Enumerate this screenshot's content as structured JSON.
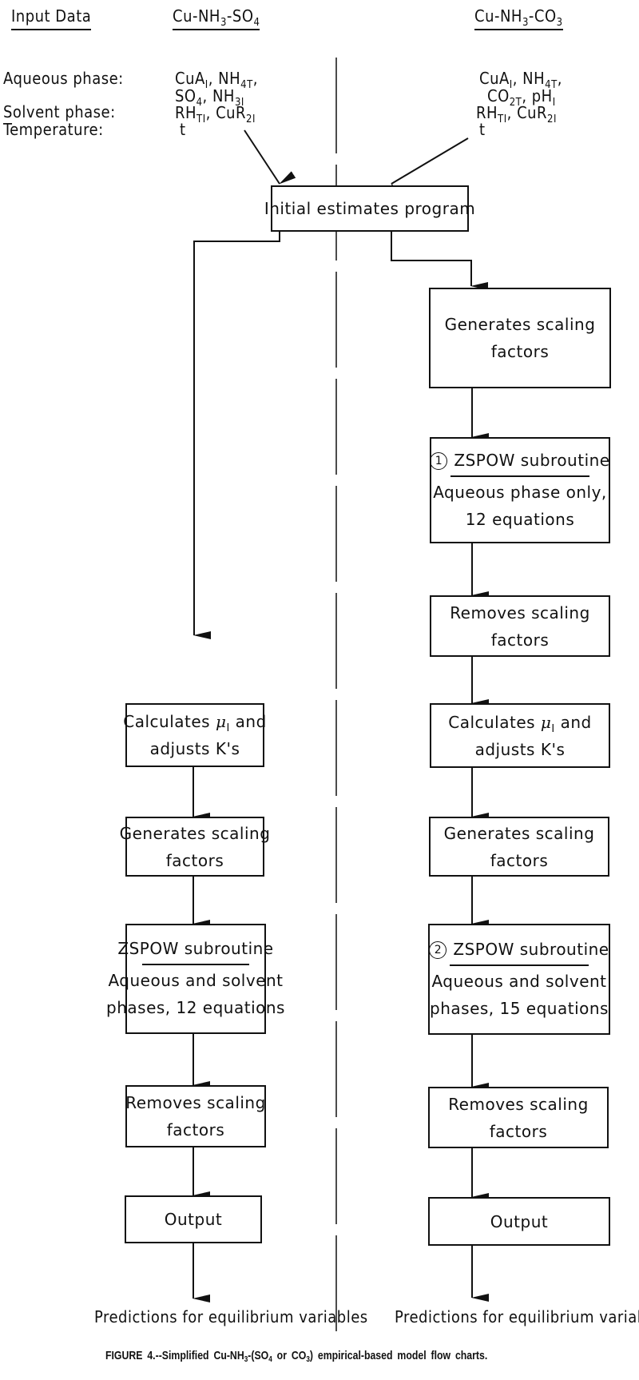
{
  "header": {
    "input_data_label": "Input Data",
    "sulfate_system": {
      "base": "Cu-NH",
      "sub1": "3",
      "mid": "-SO",
      "sub2": "4"
    },
    "carbonate_system": {
      "base": "Cu-NH",
      "sub1": "3",
      "mid": "-CO",
      "sub2": "3"
    }
  },
  "input_labels": {
    "aqueous": "Aqueous phase:",
    "solvent": "Solvent phase:",
    "temperature": "Temperature:"
  },
  "sulfate_inputs": {
    "aqueous_line1": [
      {
        "t": "CuA",
        "s": "I"
      },
      {
        "t": ", NH",
        "s": "4T"
      },
      {
        "t": ",",
        "s": ""
      }
    ],
    "aqueous_line2": [
      {
        "t": "SO",
        "s": "4"
      },
      {
        "t": ", NH",
        "s": "3I"
      }
    ],
    "solvent": [
      {
        "t": "RH",
        "s": "TI"
      },
      {
        "t": ", CuR",
        "s": "2I"
      }
    ],
    "temperature": "t"
  },
  "carbonate_inputs": {
    "aqueous_line1": [
      {
        "t": "CuA",
        "s": "I"
      },
      {
        "t": ", NH",
        "s": "4T"
      },
      {
        "t": ",",
        "s": ""
      }
    ],
    "aqueous_line2": [
      {
        "t": "CO",
        "s": "2T"
      },
      {
        "t": ", pH",
        "s": "I"
      }
    ],
    "solvent": [
      {
        "t": "RH",
        "s": "TI"
      },
      {
        "t": ", CuR",
        "s": "2I"
      }
    ],
    "temperature": "t"
  },
  "shared": {
    "initial_estimates": "Initial estimates program"
  },
  "left_flow": {
    "calc_line1_pre": "Calculates ",
    "calc_mu": "μ",
    "calc_mu_sub": "I",
    "calc_line1_post": " and",
    "calc_line2": "adjusts K's",
    "gen_line1": "Generates scaling",
    "gen_line2": "factors",
    "zspow_title": "ZSPOW  subroutine",
    "zspow_line1": "Aqueous and solvent",
    "zspow_line2": "phases, 12 equations",
    "rem_line1": "Removes scaling",
    "rem_line2": "factors",
    "output": "Output",
    "result": "Predictions for equilibrium variables"
  },
  "right_flow": {
    "gen1_line1": "Generates scaling",
    "gen1_line2": "factors",
    "zspow1_num": "1",
    "zspow1_title": "ZSPOW subroutine",
    "zspow1_line1": "Aqueous phase only,",
    "zspow1_line2": "12 equations",
    "rem1_line1": "Removes scaling",
    "rem1_line2": "factors",
    "calc_line1_pre": "Calculates ",
    "calc_mu": "μ",
    "calc_mu_sub": "I",
    "calc_line1_post": " and",
    "calc_line2": "adjusts K's",
    "gen2_line1": "Generates scaling",
    "gen2_line2": "factors",
    "zspow2_num": "2",
    "zspow2_title": "ZSPOW  subroutine",
    "zspow2_line1": "Aqueous and solvent",
    "zspow2_line2": "phases, 15 equations",
    "rem2_line1": "Removes scaling",
    "rem2_line2": "factors",
    "output": "Output",
    "result": "Predictions for equilibrium variables"
  },
  "caption": {
    "pre": "FIGURE 4.--Simplified Cu-NH",
    "sub1": "3",
    "mid1": "-(SO",
    "sub2": "4",
    "mid2": " or CO",
    "sub3": "3",
    "post": ") empirical-based model flow charts."
  }
}
